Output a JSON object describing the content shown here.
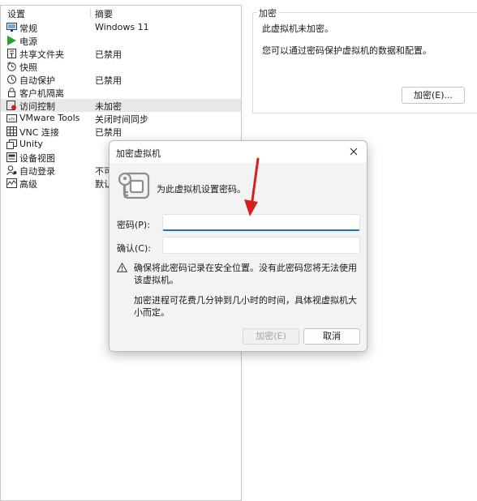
{
  "list": {
    "header_setting": "设置",
    "header_summary": "摘要",
    "items": [
      {
        "name": "常规",
        "summary": "Windows 11",
        "icon": "monitor-icon"
      },
      {
        "name": "电源",
        "summary": "",
        "icon": "play-icon"
      },
      {
        "name": "共享文件夹",
        "summary": "已禁用",
        "icon": "shared-folder-icon"
      },
      {
        "name": "快照",
        "summary": "",
        "icon": "snapshot-icon"
      },
      {
        "name": "自动保护",
        "summary": "已禁用",
        "icon": "clock-icon"
      },
      {
        "name": "客户机隔离",
        "summary": "",
        "icon": "lock-icon"
      },
      {
        "name": "访问控制",
        "summary": "未加密",
        "icon": "access-control-icon"
      },
      {
        "name": "VMware Tools",
        "summary": "关闭时间同步",
        "icon": "vmware-tools-icon"
      },
      {
        "name": "VNC 连接",
        "summary": "已禁用",
        "icon": "vnc-icon"
      },
      {
        "name": "Unity",
        "summary": "",
        "icon": "unity-icon"
      },
      {
        "name": "设备视图",
        "summary": "",
        "icon": "device-view-icon"
      },
      {
        "name": "自动登录",
        "summary": "不可",
        "icon": "autologin-icon"
      },
      {
        "name": "高级",
        "summary": "默认",
        "icon": "advanced-icon"
      }
    ]
  },
  "encryption": {
    "group_title": "加密",
    "status": "此虚拟机未加密。",
    "description": "您可以通过密码保护虚拟机的数据和配置。",
    "button_label": "加密(E)..."
  },
  "dialog": {
    "title": "加密虚拟机",
    "prompt": "为此虚拟机设置密码。",
    "password_label": "密码(P):",
    "password_value": "",
    "confirm_label": "确认(C):",
    "confirm_value": "",
    "warning": "确保将此密码记录在安全位置。没有此密码您将无法使用该虚拟机。",
    "note": "加密进程可花费几分钟到几小时的时间，具体视虚拟机大小而定。",
    "ok_label": "加密(E)",
    "cancel_label": "取消"
  },
  "colors": {
    "focus_blue": "#1a73c9",
    "arrow_red": "#d62020",
    "power_green": "#2aa12a",
    "selected_row": "#e8e8e8"
  }
}
